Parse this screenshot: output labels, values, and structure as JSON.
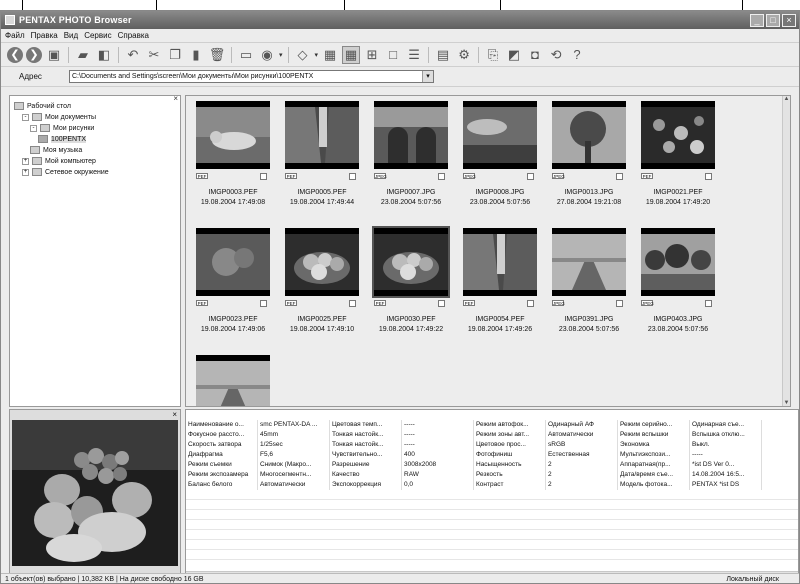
{
  "window": {
    "title": "PENTAX PHOTO Browser",
    "buttons": [
      "_",
      "□",
      "×"
    ]
  },
  "menu": [
    "Файл",
    "Правка",
    "Вид",
    "Сервис",
    "Справка"
  ],
  "address": {
    "label": "Адрес",
    "value": "C:\\Documents and Settings\\screen\\Мои документы\\Мои рисунки\\100PENTX"
  },
  "tree": [
    {
      "label": "Рабочий стол",
      "expander": "",
      "depth": 0
    },
    {
      "label": "Мои документы",
      "expander": "-",
      "depth": 1
    },
    {
      "label": "Мои рисунки",
      "expander": "-",
      "depth": 2
    },
    {
      "label": "100PENTX",
      "expander": "",
      "depth": 3
    },
    {
      "label": "Моя музыка",
      "expander": "",
      "depth": 2
    },
    {
      "label": "Мой компьютер",
      "expander": "+",
      "depth": 1
    },
    {
      "label": "Сетевое окружение",
      "expander": "+",
      "depth": 1
    }
  ],
  "thumbnails": [
    {
      "name": "IMGP0003.PEF",
      "date": "19.08.2004 17:49:08",
      "type": "PEF",
      "photo": "cat"
    },
    {
      "name": "IMGP0005.PEF",
      "date": "19.08.2004 17:49:44",
      "type": "PEF",
      "photo": "street"
    },
    {
      "name": "IMGP0007.JPG",
      "date": "23.08.2004 5:07:56",
      "type": "JPEG",
      "photo": "arch"
    },
    {
      "name": "IMGP0008.JPG",
      "date": "23.08.2004 5:07:56",
      "type": "JPEG",
      "photo": "sky"
    },
    {
      "name": "IMGP0013.JPG",
      "date": "27.08.2004 19:21:08",
      "type": "JPEG",
      "photo": "tree"
    },
    {
      "name": "IMGP0021.PEF",
      "date": "19.08.2004 17:49:20",
      "type": "PEF",
      "photo": "flowers"
    },
    {
      "name": "IMGP0023.PEF",
      "date": "19.08.2004 17:49:06",
      "type": "PEF",
      "photo": "leaves"
    },
    {
      "name": "IMGP0025.PEF",
      "date": "19.08.2004 17:49:10",
      "type": "PEF",
      "photo": "fruit"
    },
    {
      "name": "IMGP0030.PEF",
      "date": "19.08.2004 17:49:22",
      "type": "PEF",
      "photo": "fruit",
      "selected": true
    },
    {
      "name": "IMGP0054.PEF",
      "date": "19.08.2004 17:49:26",
      "type": "PEF",
      "photo": "street"
    },
    {
      "name": "IMGP0391.JPG",
      "date": "23.08.2004 5:07:56",
      "type": "JPEG",
      "photo": "road"
    },
    {
      "name": "IMGP0403.JPG",
      "date": "23.08.2004 5:07:56",
      "type": "JPEG",
      "photo": "trees"
    }
  ],
  "info": [
    [
      "Наименование о...",
      "smc PENTAX-DA ...",
      "Цветовая темп...",
      "-----",
      "Режим автофок...",
      "Одинарный АФ",
      "Режим серийно...",
      "Одинарная съе..."
    ],
    [
      "Фокусное рассто...",
      "45mm",
      "Тонкая настойк...",
      "-----",
      "Режим зоны авт...",
      "Автоматически",
      "Режим вспышки",
      "Вспышка отклю..."
    ],
    [
      "Скорость затвора",
      "1/25sec",
      "Тонкая настойк...",
      "-----",
      "Цветовое прос...",
      "sRGB",
      "Экономка",
      "Выкл."
    ],
    [
      "Диафрагма",
      "F5,6",
      "Чувствительно...",
      "400",
      "Фотофиниш",
      "Естественная",
      "Мультиэкспози...",
      "-----"
    ],
    [
      "Режим съемки",
      "Снимок (Макро...",
      "Разрешение",
      "3008x2008",
      "Насыщенность",
      "2",
      "Аппаратная(пр...",
      "*ist DS    Ver 0..."
    ],
    [
      "Режим экспозамера",
      "Многосегментн...",
      "Качество",
      "RAW",
      "Резкость",
      "2",
      "Дата/время съе...",
      "14.08.2004 16:5..."
    ],
    [
      "Баланс белого",
      "Автоматически",
      "Экспокоррекция",
      "0,0",
      "Контраст",
      "2",
      "Модель фотока...",
      "PENTAX *ist DS"
    ]
  ],
  "status": {
    "left": "1 объект(ов) выбрано | 10,382 KB | На диске свободно 16 GB",
    "right": "Локальный диск"
  },
  "pane_close": "×",
  "scroll": {
    "up": "▲",
    "down": "▼",
    "left": "◀",
    "right": "▶"
  }
}
